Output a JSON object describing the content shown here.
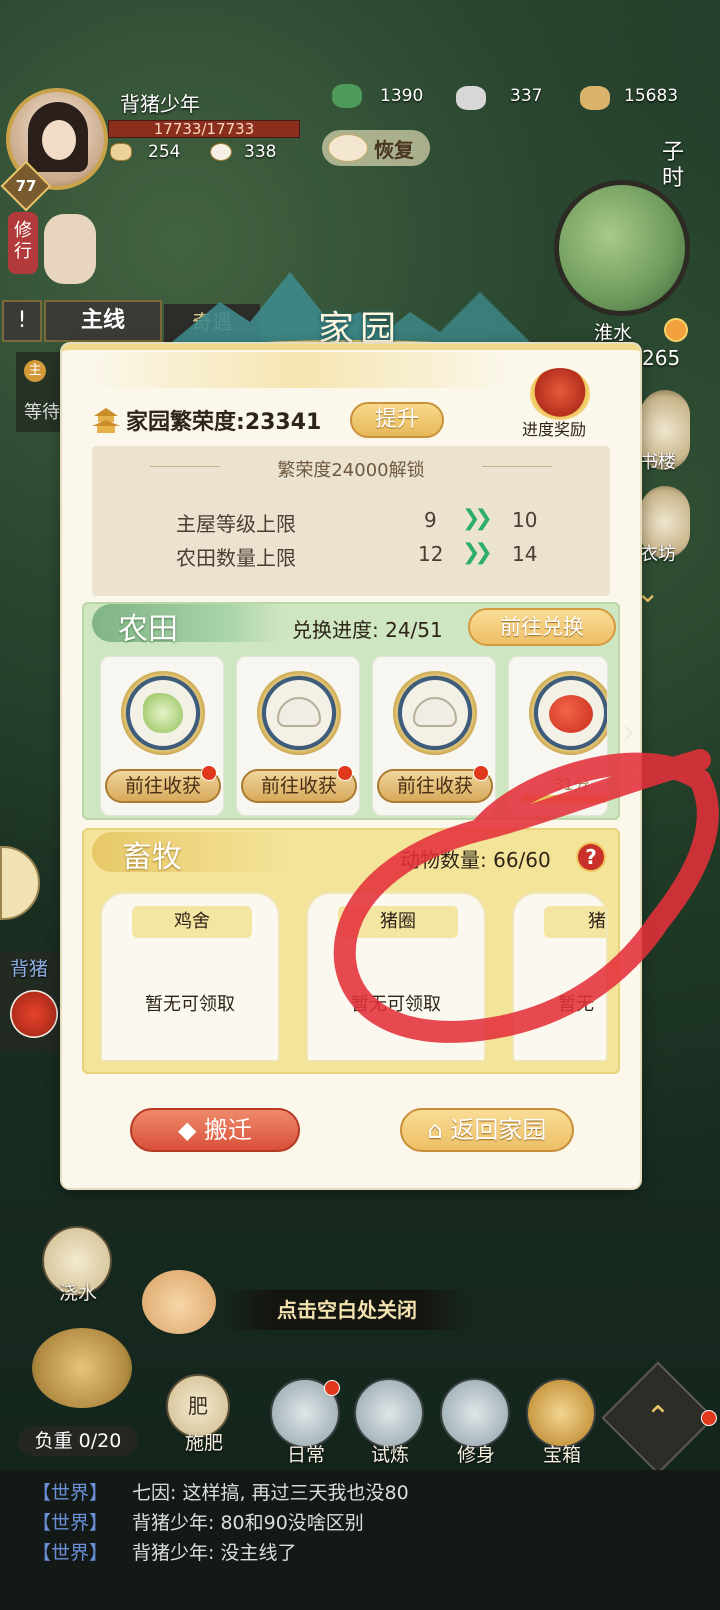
{
  "player": {
    "name": "背猪少年",
    "hp": "17733/17733",
    "level": "77",
    "stat_a": "254",
    "stat_b": "338"
  },
  "resources": [
    {
      "icon": "jade-icon",
      "value": "1390"
    },
    {
      "icon": "silver-ingot-icon",
      "value": "337"
    },
    {
      "icon": "coins-icon",
      "value": "15683"
    }
  ],
  "recover_label": "恢复",
  "time_label": "子时",
  "location": "淮水",
  "side_number": "265",
  "xiuxing_label": "修行",
  "quest_tabs": {
    "main": "主线",
    "other": "奇遇",
    "icon": "!"
  },
  "quest_peek": {
    "icon": "主",
    "text": "等待"
  },
  "side_peek": {
    "name": "背猪",
    "btn1": "书楼",
    "btn2": "衣坊"
  },
  "panel": {
    "title": "家园",
    "prosperity_label": "家园繁荣度:",
    "prosperity_value": "23341",
    "upgrade_button": "提升",
    "reward_label": "进度奖励",
    "unlock_title": "繁荣度24000解锁",
    "unlock_rows": [
      {
        "label": "主屋等级上限",
        "from": "9",
        "to": "10"
      },
      {
        "label": "农田数量上限",
        "from": "12",
        "to": "14"
      }
    ],
    "farm": {
      "title": "农田",
      "progress_label": "兑换进度:",
      "progress_value": "24/51",
      "exchange_button": "前往兑换",
      "cards": [
        {
          "crop": "cabbage-icon",
          "button": "前往收获"
        },
        {
          "crop": "mushroom-icon",
          "button": "前往收获"
        },
        {
          "crop": "mushroom-icon",
          "button": "前往收获"
        },
        {
          "crop": "tomato-icon",
          "timer": "31分",
          "progress": 0.85
        }
      ]
    },
    "pasture": {
      "title": "畜牧",
      "count_label": "动物数量:",
      "count_value": "66/60",
      "help": "?",
      "pens": [
        {
          "name": "鸡舍",
          "status": "暂无可领取"
        },
        {
          "name": "猪圈",
          "status": "暂无可领取"
        },
        {
          "name": "猪",
          "status": "暂无"
        }
      ]
    },
    "move_button": "搬迁",
    "home_button": "返回家园"
  },
  "close_hint": "点击空白处关闭",
  "bottom": {
    "water": "浇水",
    "fertilize": "施肥",
    "fertilize_sub": "肥",
    "weight": "负重 0/20"
  },
  "nav": [
    {
      "label": "日常"
    },
    {
      "label": "试炼"
    },
    {
      "label": "修身"
    },
    {
      "label": "宝箱"
    }
  ],
  "chat": [
    {
      "channel": "【世界】",
      "text": "七因: 这样搞, 再过三天我也没80"
    },
    {
      "channel": "【世界】",
      "text": "背猪少年: 80和90没啥区别"
    },
    {
      "channel": "【世界】",
      "text": "背猪少年: 没主线了"
    }
  ],
  "colors": {
    "annotation": "#e4303a",
    "accent_gold": "#edbf66",
    "farm_green": "#cfe6c2",
    "pasture_yellow": "#f3e49a"
  }
}
